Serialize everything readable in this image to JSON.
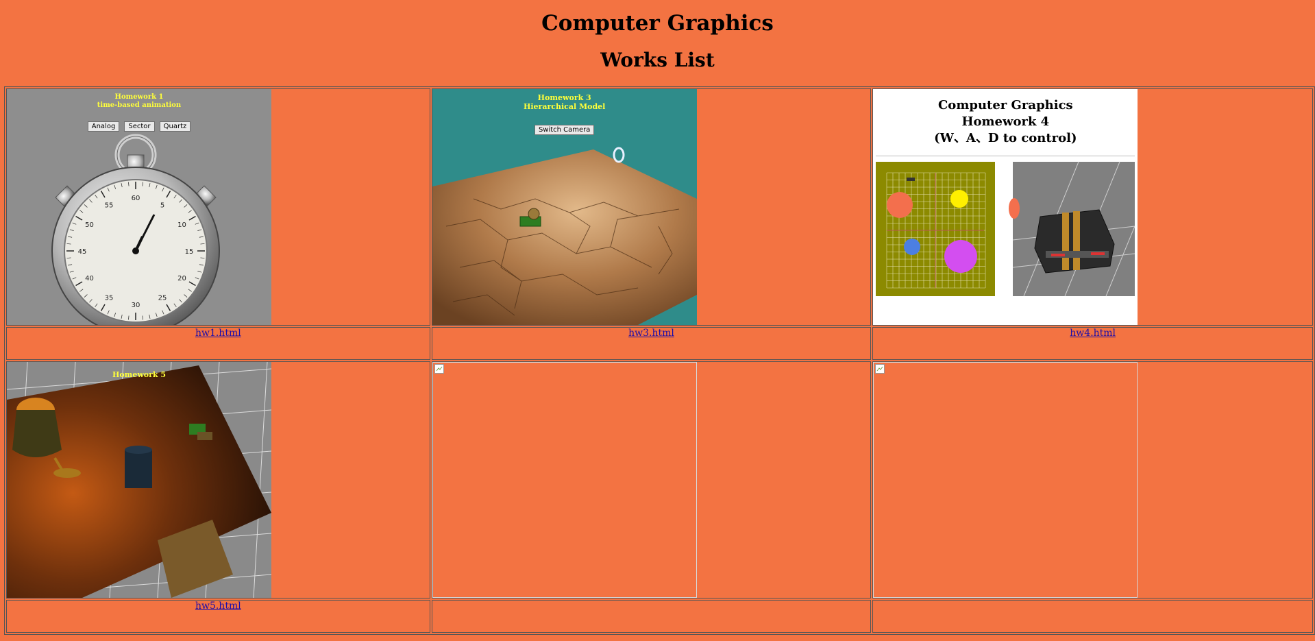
{
  "page": {
    "title": "Computer Graphics",
    "subtitle": "Works List"
  },
  "works": [
    {
      "link": "hw1.html",
      "caption_lines": [
        "Homework 1",
        "time-based animation"
      ],
      "buttons": [
        "Analog",
        "Sector",
        "Quartz"
      ],
      "dial_numbers": [
        "60",
        "5",
        "10",
        "15",
        "20",
        "25",
        "30",
        "35",
        "40",
        "45",
        "50",
        "55"
      ]
    },
    {
      "link": "hw3.html",
      "caption_lines": [
        "Homework 3",
        "Hierarchical Model"
      ],
      "button": "Switch Camera"
    },
    {
      "link": "hw4.html",
      "caption_lines": [
        "Computer Graphics",
        "Homework 4",
        "(W、A、D to control)"
      ]
    },
    {
      "link": "hw5.html",
      "caption": "Homework 5"
    },
    {
      "link": ""
    },
    {
      "link": ""
    }
  ],
  "colors": {
    "background": "#f37342",
    "link": "#1a0dab",
    "caption_yellow": "#ffff3a"
  }
}
